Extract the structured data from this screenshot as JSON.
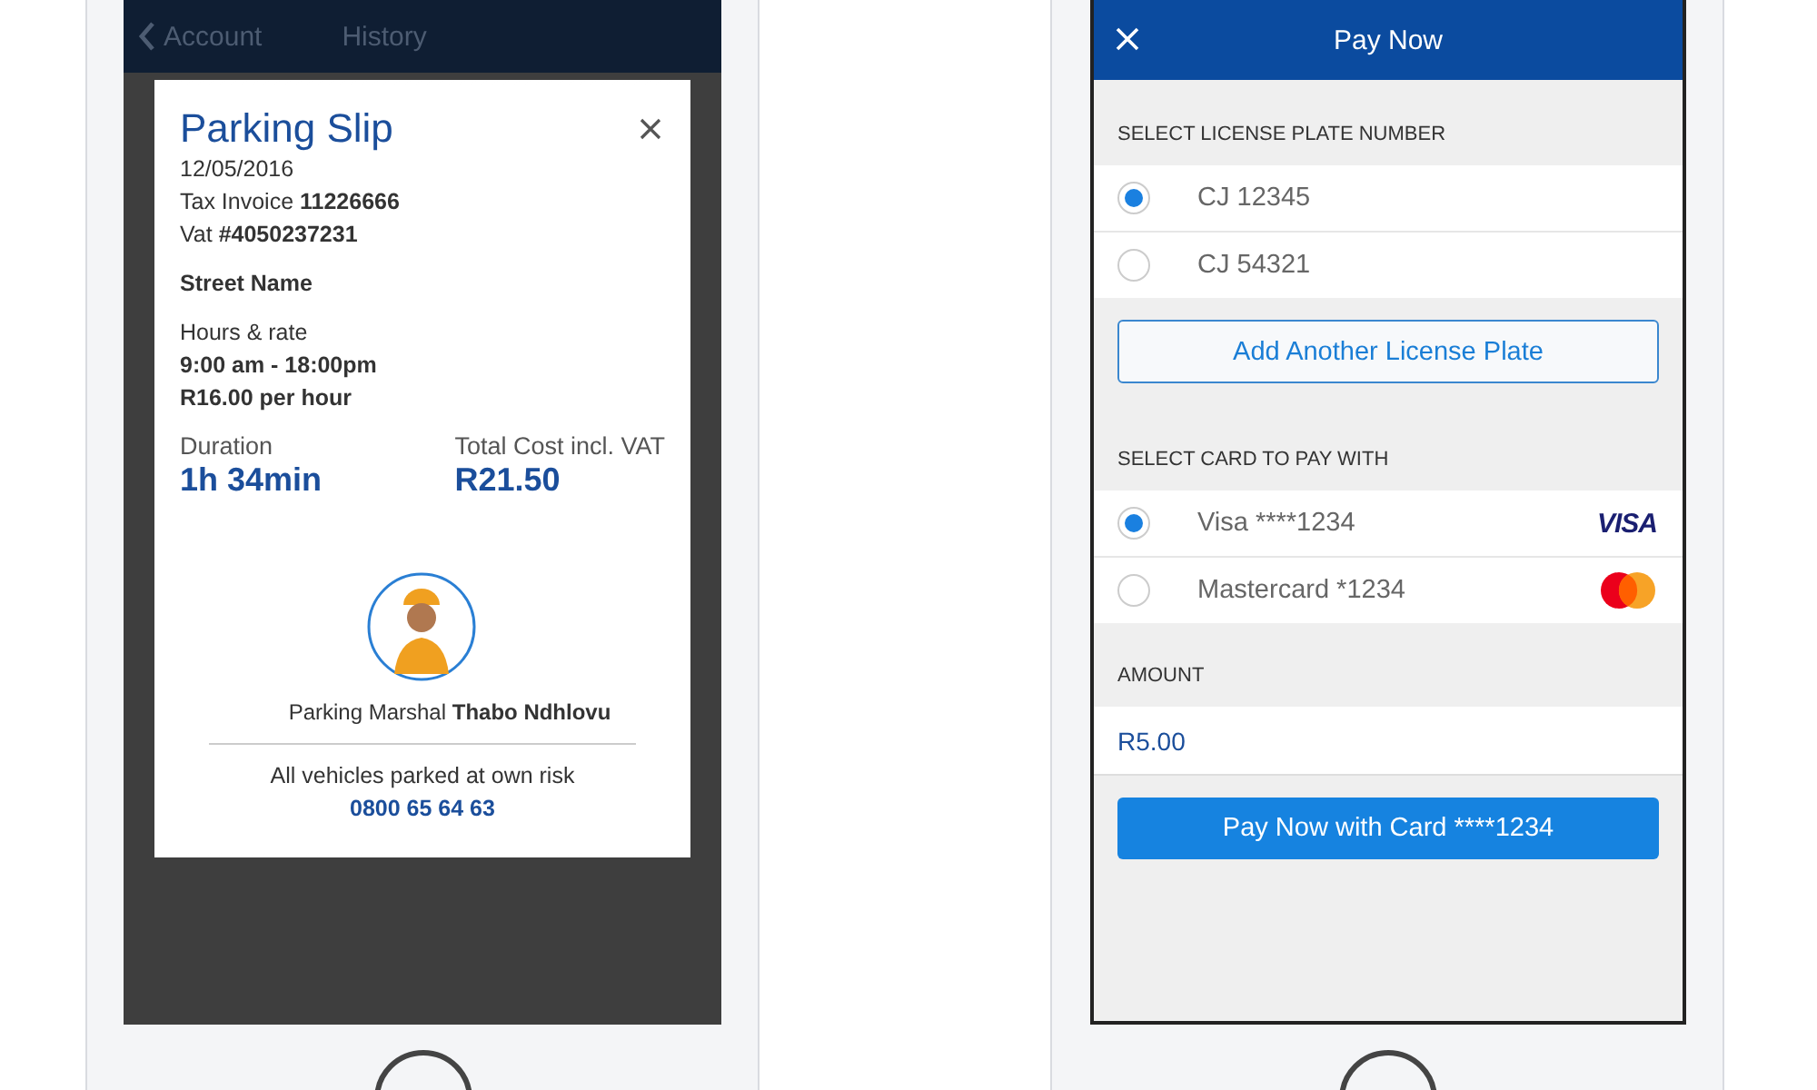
{
  "slip_screen": {
    "nav": {
      "back_label": "Account",
      "title": "History"
    },
    "slip": {
      "title": "Parking Slip",
      "date": "12/05/2016",
      "tax_invoice": "Tax Invoice **11226666**",
      "vat": "Vat **#4050237231**",
      "street": "Street Name",
      "hours_label": "Hours & rate",
      "hours": "9:00 am - 18:00pm",
      "rate": "R16.00 per hour",
      "duration_label": "Duration",
      "duration": "1h 34min",
      "total_label": "Total Cost incl. VAT",
      "total": "R21.50",
      "marshal": "Parking Marshal **Thabo Ndhlovu**",
      "disclaimer": "All vehicles parked at own risk",
      "phone": "0800 65 64 63"
    }
  },
  "pay_screen": {
    "title": "Pay Now",
    "plate_section": "SELECT LICENSE PLATE NUMBER",
    "plates": [
      {
        "label": "CJ 12345",
        "selected": true
      },
      {
        "label": "CJ 54321",
        "selected": false
      }
    ],
    "add_plate_button": "Add Another License Plate",
    "card_section": "SELECT CARD TO PAY WITH",
    "cards": [
      {
        "label": "Visa ****1234",
        "kind": "visa",
        "logo_text": "VISA",
        "selected": true
      },
      {
        "label": "Mastercard *1234",
        "kind": "mastercard",
        "selected": false
      }
    ],
    "amount_section": "AMOUNT",
    "amount": "R5.00",
    "pay_button": "Pay Now with Card ****1234"
  }
}
